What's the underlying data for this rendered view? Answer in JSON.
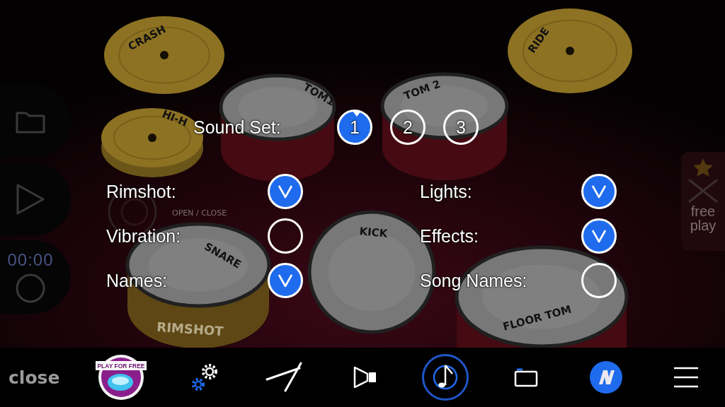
{
  "side_panel": {
    "timer": "00:00"
  },
  "kit": {
    "pieces": [
      {
        "kind": "cymbal",
        "label": "CRASH"
      },
      {
        "kind": "cymbal",
        "label": "HI-H"
      },
      {
        "kind": "tom",
        "label": "TOM1"
      },
      {
        "kind": "tom",
        "label": "TOM 2"
      },
      {
        "kind": "cymbal",
        "label": "RIDE"
      },
      {
        "kind": "kick",
        "label": "KICK"
      },
      {
        "kind": "snare",
        "label": "SNARE",
        "rim_label": "RIMSHOT"
      },
      {
        "kind": "floor",
        "label": "FLOOR TOM"
      }
    ],
    "pedal_label": "OPEN / CLOSE"
  },
  "settings": {
    "sound_set": {
      "label": "Sound Set:",
      "options": [
        {
          "label": "1",
          "selected": true
        },
        {
          "label": "2",
          "selected": false
        },
        {
          "label": "3",
          "selected": false
        }
      ]
    },
    "toggles": [
      {
        "label": "Rimshot:",
        "checked": true
      },
      {
        "label": "Lights:",
        "checked": true
      },
      {
        "label": "Vibration:",
        "checked": false
      },
      {
        "label": "Effects:",
        "checked": true
      },
      {
        "label": "Names:",
        "checked": true
      },
      {
        "label": "Song Names:",
        "checked": false
      }
    ]
  },
  "free_play": {
    "label": "free play"
  },
  "bottom_bar": {
    "close": "close",
    "items": [
      {
        "kind": "promo",
        "label": "PLAY FOR FREE",
        "selected": false
      },
      {
        "kind": "settings",
        "selected": false
      },
      {
        "kind": "sticks",
        "selected": false
      },
      {
        "kind": "video",
        "selected": false
      },
      {
        "kind": "note",
        "selected": true
      },
      {
        "kind": "folder",
        "selected": false
      },
      {
        "kind": "logo",
        "selected": false
      },
      {
        "kind": "menu",
        "selected": false
      }
    ]
  }
}
